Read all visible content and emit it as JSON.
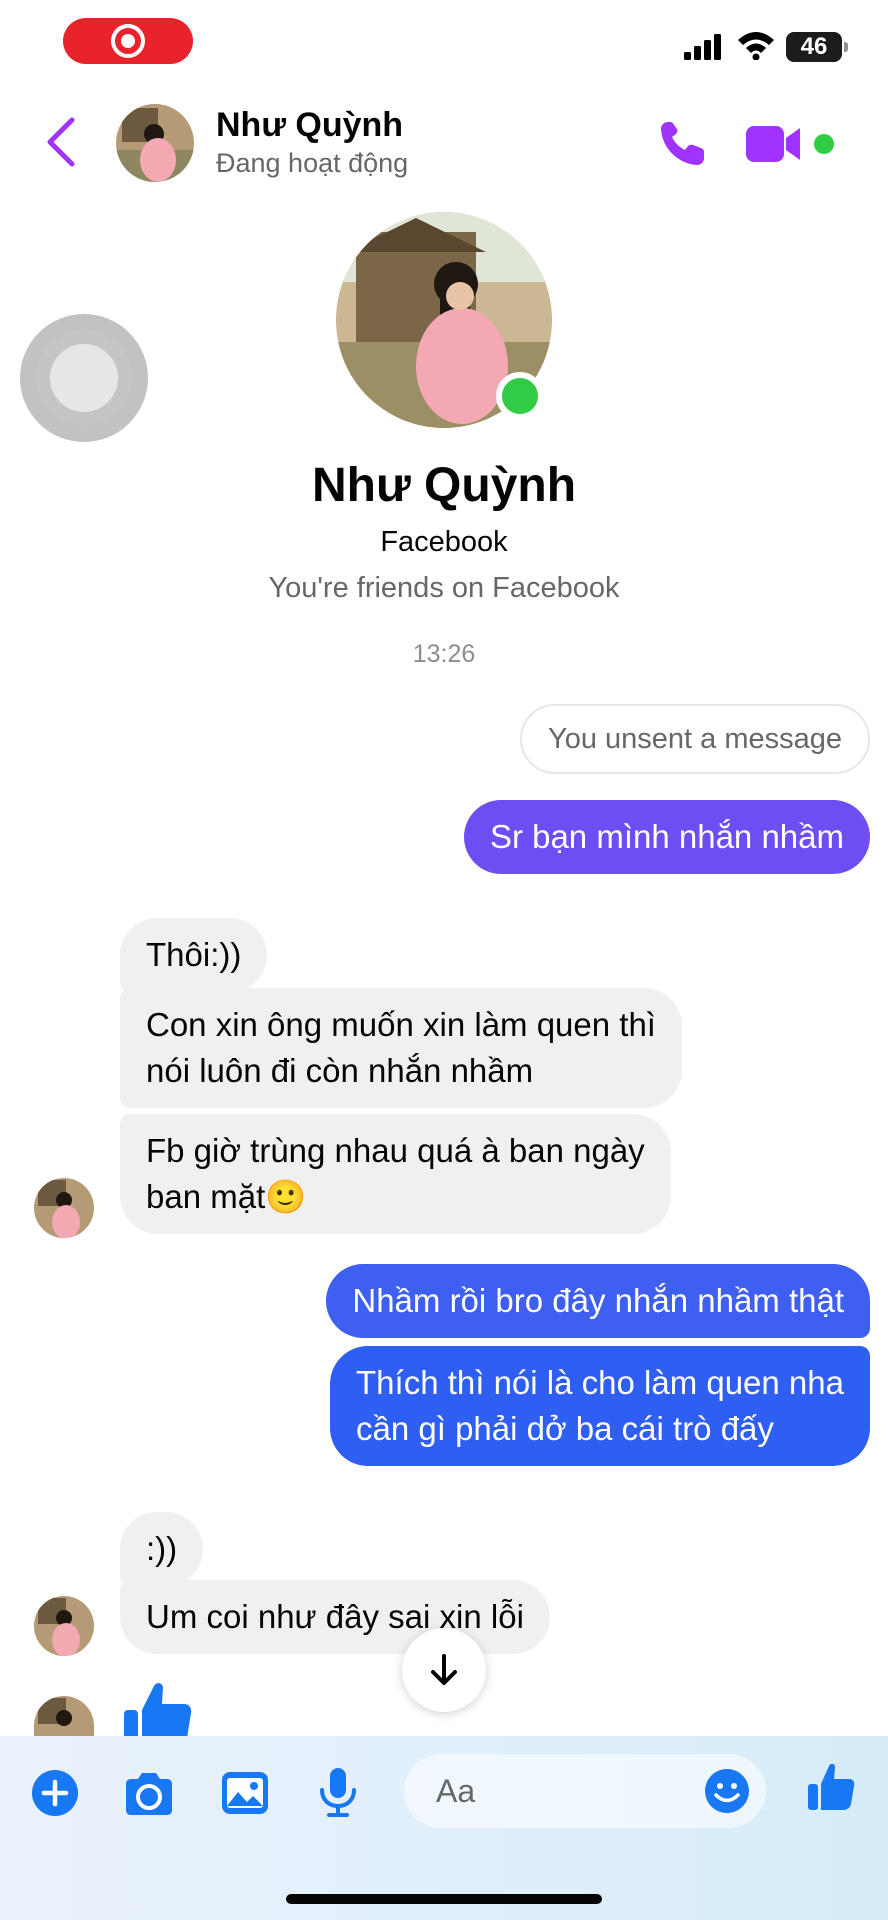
{
  "status_bar": {
    "battery": "46",
    "recording": true
  },
  "header": {
    "name": "Như Quỳnh",
    "status": "Đang hoạt động"
  },
  "profile": {
    "name": "Như Quỳnh",
    "platform": "Facebook",
    "relationship": "You're friends on Facebook"
  },
  "thread": {
    "timestamp": "13:26",
    "unsent_notice": "You unsent a message",
    "messages": [
      {
        "from": "me",
        "text": "Sr bạn mình nhắn nhầm"
      },
      {
        "from": "them",
        "text": "Thôi:))"
      },
      {
        "from": "them",
        "text": "Con xin ông muốn xin làm quen thì\nnói luôn đi còn nhắn nhầm"
      },
      {
        "from": "them",
        "text": "Fb giờ trùng nhau quá à ban ngày\nban mặt🙂"
      },
      {
        "from": "me",
        "text": "Nhầm rồi bro đây nhắn nhầm thật"
      },
      {
        "from": "me",
        "text": "Thích thì nói là cho làm quen nha\ncần gì phải dở ba cái trò đấy"
      },
      {
        "from": "them",
        "text": ":))"
      },
      {
        "from": "them",
        "text": "Um coi như đây sai xin lỗi"
      },
      {
        "from": "them",
        "text": "👍",
        "type": "like"
      }
    ]
  },
  "composer": {
    "placeholder": "Aa"
  },
  "colors": {
    "accent_purple": "#a033ff",
    "bubble_purple": "#6e4df2",
    "bubble_blue": "#2f5ff2",
    "like_blue": "#1877f2",
    "online_green": "#31cc46",
    "incoming_bubble": "#f0f0f0"
  },
  "icons": [
    "back-chevron",
    "phone",
    "video-camera",
    "plus",
    "camera",
    "gallery",
    "microphone",
    "emoji",
    "thumbs-up",
    "arrow-down"
  ]
}
